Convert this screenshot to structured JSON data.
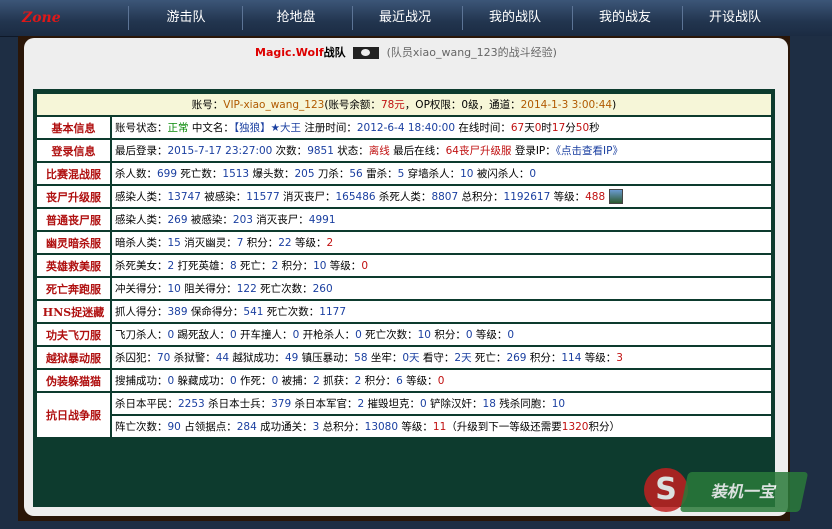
{
  "nav": {
    "logo": "Zone",
    "items": [
      "游击队",
      "抢地盘",
      "最近战况",
      "我的战队",
      "我的战友",
      "开设战队"
    ]
  },
  "team": {
    "name_prefix": "Magic.",
    "name_mid": "Wolf",
    "name_suffix": "战队",
    "member_note": "(队员xiao_wang_123的战斗经验)"
  },
  "account": {
    "label": "账号：",
    "id": "VIP-xiao_wang_123",
    "balance_label": "账号余额：",
    "balance": "78元",
    "op_label": "，OP权限：",
    "op": "0级",
    "channel_label": "，通道：",
    "channel": "2014-1-3 3:00:44",
    "close": ")"
  },
  "rows": [
    {
      "label": "基本信息",
      "parts": [
        {
          "t": "账号状态："
        },
        {
          "t": "正常",
          "c": "g"
        },
        {
          "t": " 中文名："
        },
        {
          "t": "【独狼】★大王",
          "c": "v"
        },
        {
          "t": " 注册时间："
        },
        {
          "t": "2012-6-4 18:40:00",
          "c": "v"
        },
        {
          "t": " 在线时间："
        },
        {
          "t": "67",
          "c": "r"
        },
        {
          "t": "天"
        },
        {
          "t": "0",
          "c": "r"
        },
        {
          "t": "时"
        },
        {
          "t": "17",
          "c": "r"
        },
        {
          "t": "分"
        },
        {
          "t": "50",
          "c": "r"
        },
        {
          "t": "秒"
        }
      ]
    },
    {
      "label": "登录信息",
      "parts": [
        {
          "t": "最后登录："
        },
        {
          "t": "2015-7-17 23:27:00",
          "c": "v"
        },
        {
          "t": " 次数："
        },
        {
          "t": "9851",
          "c": "v"
        },
        {
          "t": " 状态："
        },
        {
          "t": "离线",
          "c": "r"
        },
        {
          "t": " 最后在线："
        },
        {
          "t": "64丧尸升级服",
          "c": "r"
        },
        {
          "t": " 登录IP："
        },
        {
          "t": "《点击查看IP》",
          "c": "v"
        }
      ]
    },
    {
      "label": "比赛混战服",
      "parts": [
        {
          "t": "杀人数："
        },
        {
          "t": "699",
          "c": "v"
        },
        {
          "t": " 死亡数："
        },
        {
          "t": "1513",
          "c": "v"
        },
        {
          "t": " 爆头数："
        },
        {
          "t": "205",
          "c": "v"
        },
        {
          "t": " 刀杀："
        },
        {
          "t": "56",
          "c": "v"
        },
        {
          "t": " 雷杀："
        },
        {
          "t": "5",
          "c": "v"
        },
        {
          "t": " 穿墙杀人："
        },
        {
          "t": "10",
          "c": "v"
        },
        {
          "t": " 被闪杀人："
        },
        {
          "t": "0",
          "c": "v"
        }
      ]
    },
    {
      "label": "丧尸升级服",
      "parts": [
        {
          "t": "感染人类："
        },
        {
          "t": "13747",
          "c": "v"
        },
        {
          "t": " 被感染："
        },
        {
          "t": "11577",
          "c": "v"
        },
        {
          "t": " 消灭丧尸："
        },
        {
          "t": "165486",
          "c": "v"
        },
        {
          "t": " 杀死人类："
        },
        {
          "t": "8807",
          "c": "v"
        },
        {
          "t": " 总积分："
        },
        {
          "t": "1192617",
          "c": "v"
        },
        {
          "t": " 等级："
        },
        {
          "t": "488",
          "c": "r"
        }
      ],
      "avatar": true
    },
    {
      "label": "普通丧尸服",
      "parts": [
        {
          "t": "感染人类："
        },
        {
          "t": "269",
          "c": "v"
        },
        {
          "t": " 被感染："
        },
        {
          "t": "203",
          "c": "v"
        },
        {
          "t": " 消灭丧尸："
        },
        {
          "t": "4991",
          "c": "v"
        }
      ]
    },
    {
      "label": "幽灵暗杀服",
      "parts": [
        {
          "t": "暗杀人类："
        },
        {
          "t": "15",
          "c": "v"
        },
        {
          "t": " 消灭幽灵："
        },
        {
          "t": "7",
          "c": "v"
        },
        {
          "t": " 积分："
        },
        {
          "t": "22",
          "c": "v"
        },
        {
          "t": " 等级："
        },
        {
          "t": "2",
          "c": "r"
        }
      ]
    },
    {
      "label": "英雄救美服",
      "parts": [
        {
          "t": "杀死美女："
        },
        {
          "t": "2",
          "c": "v"
        },
        {
          "t": " 打死英雄："
        },
        {
          "t": "8",
          "c": "v"
        },
        {
          "t": " 死亡："
        },
        {
          "t": "2",
          "c": "v"
        },
        {
          "t": " 积分："
        },
        {
          "t": "10",
          "c": "v"
        },
        {
          "t": " 等级："
        },
        {
          "t": "0",
          "c": "r"
        }
      ]
    },
    {
      "label": "死亡奔跑服",
      "parts": [
        {
          "t": "冲关得分："
        },
        {
          "t": "10",
          "c": "v"
        },
        {
          "t": " 阻关得分："
        },
        {
          "t": "122",
          "c": "v"
        },
        {
          "t": " 死亡次数："
        },
        {
          "t": "260",
          "c": "v"
        }
      ]
    },
    {
      "label": "HNS捉迷藏",
      "parts": [
        {
          "t": "抓人得分："
        },
        {
          "t": "389",
          "c": "v"
        },
        {
          "t": " 保命得分："
        },
        {
          "t": "541",
          "c": "v"
        },
        {
          "t": " 死亡次数："
        },
        {
          "t": "1177",
          "c": "v"
        }
      ]
    },
    {
      "label": "功夫飞刀服",
      "parts": [
        {
          "t": "飞刀杀人："
        },
        {
          "t": "0",
          "c": "v"
        },
        {
          "t": " 踢死敌人："
        },
        {
          "t": "0",
          "c": "v"
        },
        {
          "t": " 开车撞人："
        },
        {
          "t": "0",
          "c": "v"
        },
        {
          "t": " 开枪杀人："
        },
        {
          "t": "0",
          "c": "v"
        },
        {
          "t": " 死亡次数："
        },
        {
          "t": "10",
          "c": "v"
        },
        {
          "t": " 积分："
        },
        {
          "t": "0",
          "c": "v"
        },
        {
          "t": " 等级："
        },
        {
          "t": "0",
          "c": "v"
        }
      ]
    },
    {
      "label": "越狱暴动服",
      "parts": [
        {
          "t": "杀囚犯："
        },
        {
          "t": "70",
          "c": "v"
        },
        {
          "t": " 杀狱警："
        },
        {
          "t": "44",
          "c": "v"
        },
        {
          "t": " 越狱成功："
        },
        {
          "t": "49",
          "c": "v"
        },
        {
          "t": " 镇压暴动："
        },
        {
          "t": "58",
          "c": "v"
        },
        {
          "t": " 坐牢："
        },
        {
          "t": "0天",
          "c": "v"
        },
        {
          "t": " 看守："
        },
        {
          "t": "2天",
          "c": "v"
        },
        {
          "t": " 死亡："
        },
        {
          "t": "269",
          "c": "v"
        },
        {
          "t": " 积分："
        },
        {
          "t": "114",
          "c": "v"
        },
        {
          "t": " 等级："
        },
        {
          "t": "3",
          "c": "r"
        }
      ]
    },
    {
      "label": "伪装躲猫猫",
      "parts": [
        {
          "t": "搜捕成功："
        },
        {
          "t": "0",
          "c": "v"
        },
        {
          "t": " 躲藏成功："
        },
        {
          "t": "0",
          "c": "v"
        },
        {
          "t": " 作死："
        },
        {
          "t": "0",
          "c": "v"
        },
        {
          "t": " 被捕："
        },
        {
          "t": "2",
          "c": "v"
        },
        {
          "t": " 抓获："
        },
        {
          "t": "2",
          "c": "v"
        },
        {
          "t": " 积分："
        },
        {
          "t": "6",
          "c": "v"
        },
        {
          "t": " 等级："
        },
        {
          "t": "0",
          "c": "r"
        }
      ]
    },
    {
      "label": "抗日战争服",
      "parts": [
        {
          "t": "杀日本平民："
        },
        {
          "t": "2253",
          "c": "v"
        },
        {
          "t": " 杀日本士兵："
        },
        {
          "t": "379",
          "c": "v"
        },
        {
          "t": " 杀日本军官："
        },
        {
          "t": "2",
          "c": "v"
        },
        {
          "t": " 摧毁坦克："
        },
        {
          "t": "0",
          "c": "v"
        },
        {
          "t": " 铲除汉奸："
        },
        {
          "t": "18",
          "c": "v"
        },
        {
          "t": " 残杀同胞："
        },
        {
          "t": "10",
          "c": "v"
        }
      ],
      "parts2": [
        {
          "t": "阵亡次数："
        },
        {
          "t": "90",
          "c": "v"
        },
        {
          "t": " 占领据点："
        },
        {
          "t": "284",
          "c": "v"
        },
        {
          "t": " 成功通关："
        },
        {
          "t": "3",
          "c": "v"
        },
        {
          "t": " 总积分："
        },
        {
          "t": "13080",
          "c": "v"
        },
        {
          "t": " 等级："
        },
        {
          "t": "11",
          "c": "r"
        },
        {
          "t": "（升级到下一等级还需要"
        },
        {
          "t": "1320",
          "c": "r"
        },
        {
          "t": "积分）"
        }
      ]
    }
  ],
  "watermark": {
    "letter": "S",
    "text": "装机一宝"
  }
}
